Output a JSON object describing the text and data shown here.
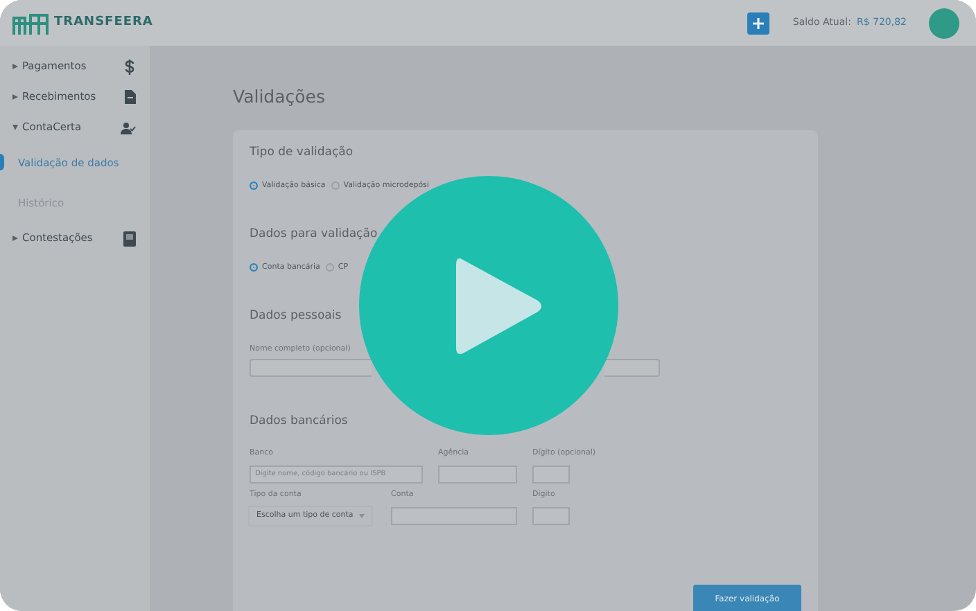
{
  "header": {
    "logo": "TRANSFEERA",
    "balance_label": "Saldo Atual:",
    "balance_value": "R$ 720,82"
  },
  "sidebar": {
    "items": [
      {
        "label": "Pagamentos",
        "expanded": false
      },
      {
        "label": "Recebimentos",
        "expanded": false
      },
      {
        "label": "ContaCerta",
        "expanded": true,
        "children": [
          {
            "label": "Validação de dados",
            "selected": true
          },
          {
            "label": "Histórico",
            "selected": false
          }
        ]
      },
      {
        "label": "Contestações",
        "expanded": false
      }
    ]
  },
  "page": {
    "title": "Validações",
    "sections": [
      {
        "kind": "radios",
        "title": "Tipo de validação",
        "options": [
          {
            "label": "Validação básica",
            "selected": true
          },
          {
            "label": "Validação microdepósi",
            "selected": false
          }
        ]
      },
      {
        "kind": "radios",
        "title": "Dados para validação",
        "options": [
          {
            "label": "Conta bancária",
            "selected": true
          },
          {
            "label": "CP",
            "selected": false
          }
        ]
      },
      {
        "kind": "personal",
        "title": "Dados pessoais",
        "fields": [
          {
            "label": "Nome completo (opcional)"
          }
        ]
      },
      {
        "kind": "bank",
        "title": "Dados bancários",
        "rows": [
          [
            {
              "kind": "input",
              "label": "Banco",
              "placeholder": "Digite nome, código bancário ou ISPB"
            },
            {
              "kind": "input",
              "label": "Agência"
            },
            {
              "kind": "input",
              "label": "Dígito (opcional)"
            }
          ],
          [
            {
              "kind": "select",
              "label": "Tipo da conta",
              "value": "Escolha um tipo de conta"
            },
            {
              "kind": "input",
              "label": "Conta"
            },
            {
              "kind": "input",
              "label": "Dígito"
            }
          ]
        ]
      }
    ],
    "submit": "Fazer validação"
  }
}
